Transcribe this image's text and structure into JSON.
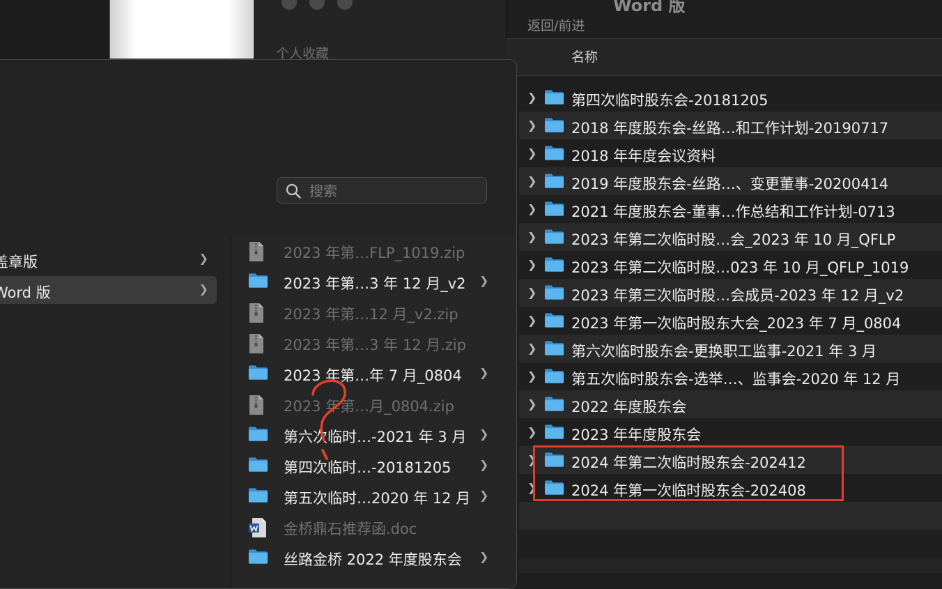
{
  "background_window": {
    "sidebar_favorites": "个人收藏"
  },
  "right_window": {
    "title": "Word 版",
    "nav_label": "返回/前进",
    "column_name": "名称",
    "rows": [
      {
        "label": "第四次临时股东会-20181205"
      },
      {
        "label": "2018 年度股东会-丝路…和工作计划-20190717"
      },
      {
        "label": "2018 年年度会议资料"
      },
      {
        "label": "2019 年度股东会-丝路…、变更董事-20200414"
      },
      {
        "label": "2021 年度股东会-董事…作总结和工作计划-0713"
      },
      {
        "label": "2023 年第二次临时股…会_2023 年 10 月_QFLP"
      },
      {
        "label": "2023 年第二次临时股…023 年 10 月_QFLP_1019"
      },
      {
        "label": "2023 年第三次临时股…会成员-2023 年 12 月_v2"
      },
      {
        "label": "2023 年第一次临时股东大会_2023 年 7 月_0804"
      },
      {
        "label": "第六次临时股东会-更换职工监事-2021 年 3 月"
      },
      {
        "label": "第五次临时股东会-选举…、监事会-2020 年 12 月"
      },
      {
        "label": "2022 年度股东会"
      },
      {
        "label": "2023 年年度股东会"
      },
      {
        "label": "2024 年第二次临时股东会-202412"
      },
      {
        "label": "2024 年第一次临时股东会-202408"
      }
    ]
  },
  "dialog": {
    "search": {
      "placeholder": "搜索",
      "value": ""
    },
    "column1": [
      {
        "label": "盖章版",
        "selected": false
      },
      {
        "label": "Word 版",
        "selected": true
      }
    ],
    "column2": [
      {
        "label": "2023 年第…FLP_1019.zip",
        "type": "zip",
        "dim": true,
        "folder": false
      },
      {
        "label": "2023 年第…3 年 12 月_v2",
        "type": "folder",
        "dim": false,
        "folder": true
      },
      {
        "label": "2023 年第…12 月_v2.zip",
        "type": "zip",
        "dim": true,
        "folder": false
      },
      {
        "label": "2023 年第…3 年 12 月.zip",
        "type": "zip",
        "dim": true,
        "folder": false
      },
      {
        "label": "2023 年第…年 7 月_0804",
        "type": "folder",
        "dim": false,
        "folder": true
      },
      {
        "label": "2023 年第…月_0804.zip",
        "type": "zip",
        "dim": true,
        "folder": false
      },
      {
        "label": "第六次临时…-2021 年 3 月",
        "type": "folder",
        "dim": false,
        "folder": true
      },
      {
        "label": "第四次临时…-20181205",
        "type": "folder",
        "dim": false,
        "folder": true
      },
      {
        "label": "第五次临时…2020 年 12 月",
        "type": "folder",
        "dim": false,
        "folder": true
      },
      {
        "label": "金桥鼎石推荐函.doc",
        "type": "doc",
        "dim": true,
        "folder": false
      },
      {
        "label": "丝路金桥 2022 年度股东会",
        "type": "folder",
        "dim": false,
        "folder": true
      }
    ]
  },
  "colors": {
    "folder": "#4aa8e8",
    "highlight": "#e53b2c",
    "annotation": "#e2412b"
  }
}
